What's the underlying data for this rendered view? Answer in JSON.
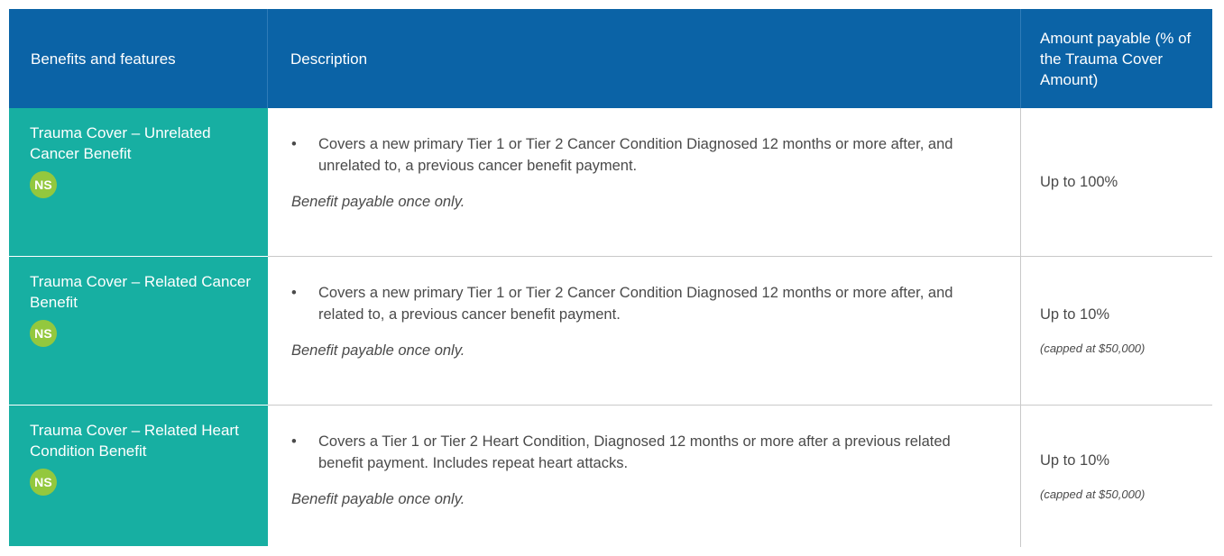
{
  "header": {
    "col1": "Benefits and features",
    "col2": "Description",
    "col3": "Amount payable (% of the Trauma Cover Amount)"
  },
  "rows": [
    {
      "feature": "Trauma Cover – Unrelated Cancer Benefit",
      "badge": "NS",
      "bullet": "Covers a new primary Tier 1 or Tier 2 Cancer Condition Diagnosed 12 months or more after, and unrelated to, a previous cancer benefit payment.",
      "note": "Benefit payable once only.",
      "amount": "Up to 100%",
      "cap": ""
    },
    {
      "feature": "Trauma Cover – Related Cancer Benefit",
      "badge": "NS",
      "bullet": "Covers a new primary Tier 1 or Tier 2 Cancer Condition Diagnosed 12 months or more after, and related to, a previous cancer benefit payment.",
      "note": "Benefit payable once only.",
      "amount": "Up to 10%",
      "cap": "(capped at $50,000)"
    },
    {
      "feature": "Trauma Cover – Related Heart Condition Benefit",
      "badge": "NS",
      "bullet": "Covers a Tier 1 or Tier 2 Heart Condition, Diagnosed 12 months or more after a previous related benefit payment. Includes repeat heart attacks.",
      "note": "Benefit payable once only.",
      "amount": "Up to 10%",
      "cap": "(capped at $50,000)"
    }
  ],
  "colors": {
    "header_bg": "#0b63a6",
    "feature_bg": "#17afa2",
    "badge_bg": "#93c83e"
  }
}
